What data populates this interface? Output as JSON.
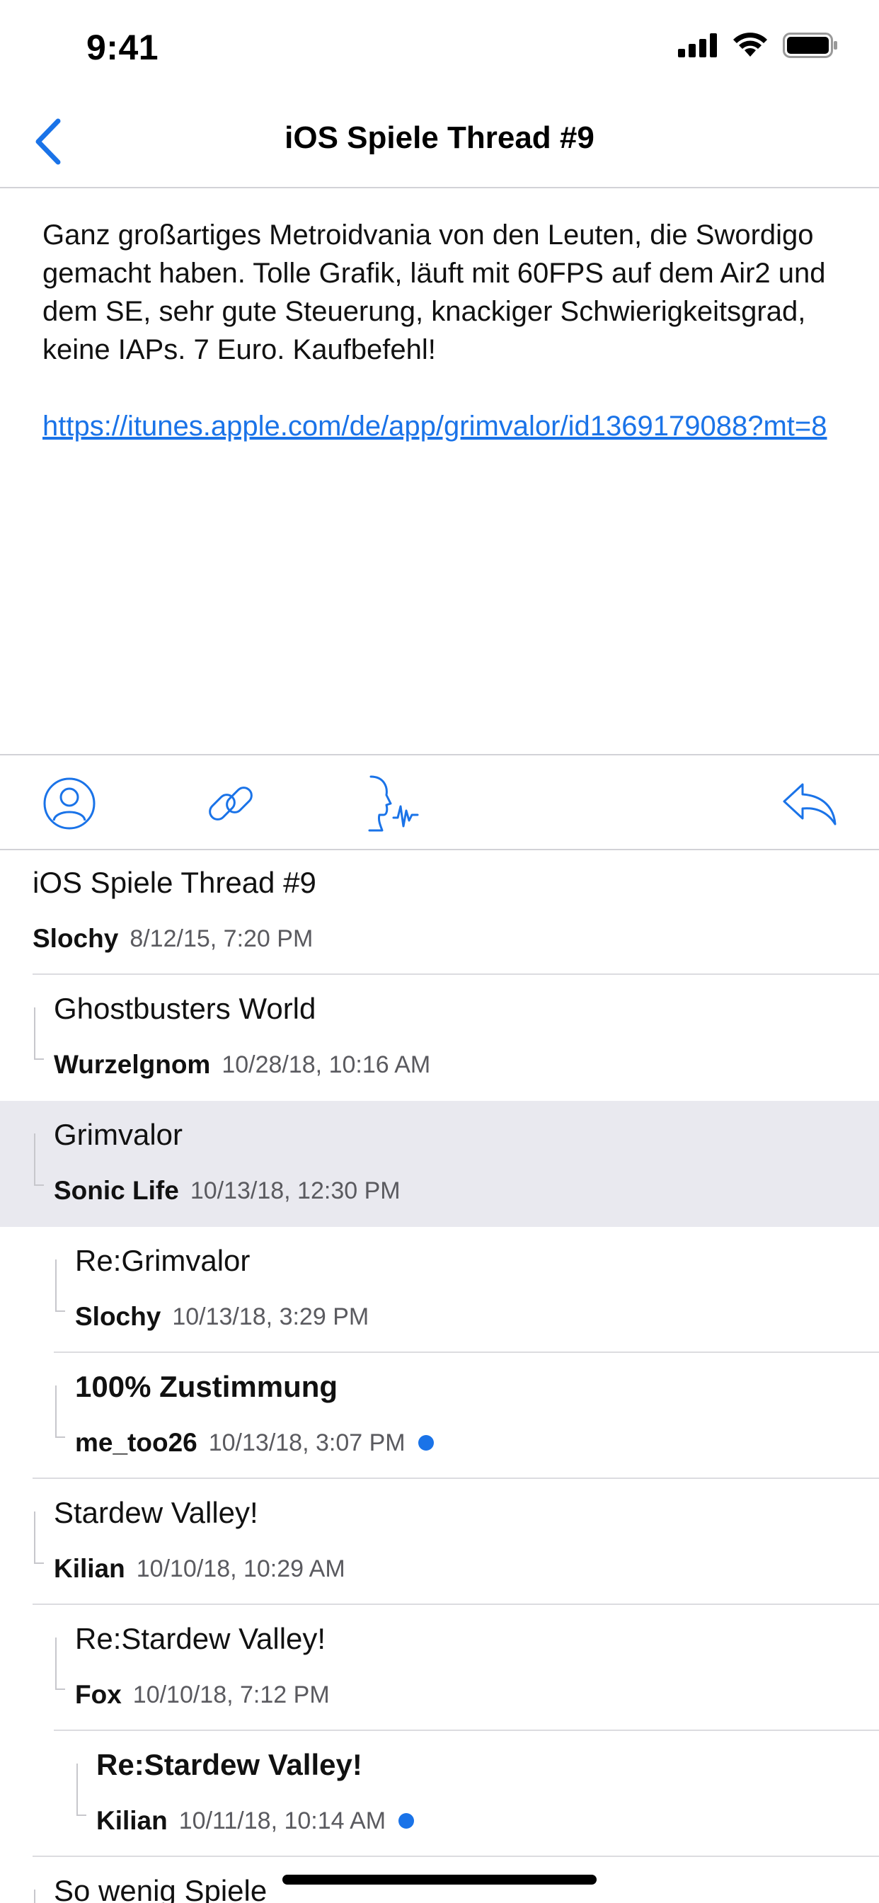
{
  "status": {
    "time": "9:41"
  },
  "nav": {
    "title": "iOS Spiele Thread #9"
  },
  "post": {
    "text": "Ganz großartiges Metroidvania von den Leuten, die Swordigo gemacht haben. Tolle Grafik, läuft mit 60FPS auf dem Air2 und dem SE, sehr gute Steuerung, knackiger Schwierigkeitsgrad, keine IAPs. 7 Euro. Kaufbefehl!",
    "link": "https://itunes.apple.com/de/app/grimvalor/id1369179088?mt=8"
  },
  "toolbar": {
    "icons": [
      "profile-icon",
      "link-icon",
      "speak-icon",
      "reply-icon"
    ]
  },
  "thread": [
    {
      "title": "iOS Spiele Thread #9",
      "author": "Slochy",
      "date": "8/12/15, 7:20 PM",
      "depth": 0,
      "unread": false,
      "selected": false
    },
    {
      "title": "Ghostbusters World",
      "author": "Wurzelgnom",
      "date": "10/28/18, 10:16 AM",
      "depth": 1,
      "unread": false,
      "selected": false
    },
    {
      "title": "Grimvalor",
      "author": "Sonic Life",
      "date": "10/13/18, 12:30 PM",
      "depth": 1,
      "unread": false,
      "selected": true
    },
    {
      "title": "Re:Grimvalor",
      "author": "Slochy",
      "date": "10/13/18, 3:29 PM",
      "depth": 2,
      "unread": false,
      "selected": false
    },
    {
      "title": "100% Zustimmung",
      "author": "me_too26",
      "date": "10/13/18, 3:07 PM",
      "depth": 2,
      "unread": true,
      "selected": false
    },
    {
      "title": "Stardew Valley!",
      "author": "Kilian",
      "date": "10/10/18, 10:29 AM",
      "depth": 1,
      "unread": false,
      "selected": false
    },
    {
      "title": "Re:Stardew Valley!",
      "author": "Fox",
      "date": "10/10/18, 7:12 PM",
      "depth": 2,
      "unread": false,
      "selected": false
    },
    {
      "title": "Re:Stardew Valley!",
      "author": "Kilian",
      "date": "10/11/18, 10:14 AM",
      "depth": 3,
      "unread": true,
      "selected": false
    },
    {
      "title": "So wenig Spiele",
      "author": "",
      "date": "",
      "depth": 1,
      "unread": false,
      "selected": false
    }
  ],
  "colors": {
    "accent": "#1a73e8",
    "selected_row": "#e9e9ef",
    "unread_dot": "#1a73e8"
  }
}
